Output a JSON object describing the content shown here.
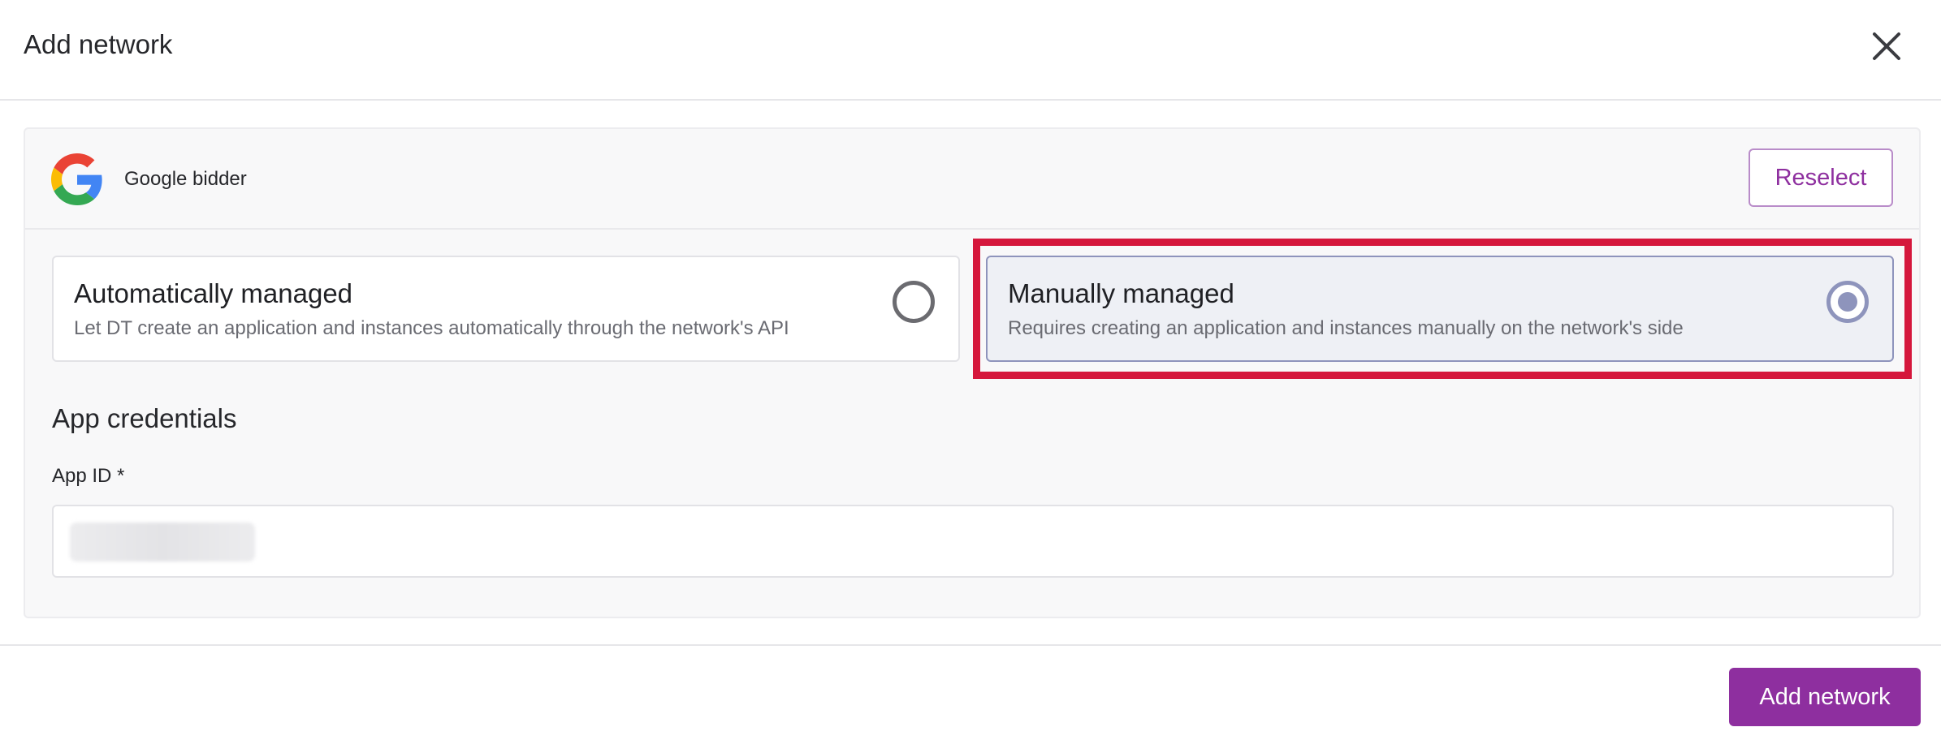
{
  "dialog": {
    "title": "Add network",
    "close_icon": "close-icon"
  },
  "network": {
    "logo_icon": "google-icon",
    "name": "Google bidder",
    "reselect_label": "Reselect"
  },
  "management": {
    "options": [
      {
        "title": "Automatically managed",
        "description": "Let DT create an application and instances automatically through the network's API",
        "selected": false
      },
      {
        "title": "Manually managed",
        "description": "Requires creating an application and instances manually on the network's side",
        "selected": true
      }
    ],
    "highlight_color": "#d5173c"
  },
  "credentials": {
    "section_title": "App credentials",
    "app_id_label": "App ID *"
  },
  "footer": {
    "submit_label": "Add network"
  },
  "colors": {
    "accent": "#8e2f9f",
    "selected_border": "#8e94bc"
  }
}
